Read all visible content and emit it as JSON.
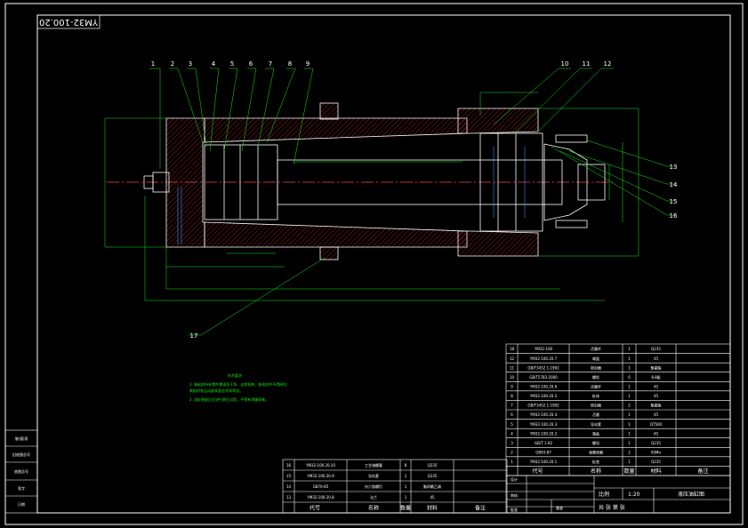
{
  "drawing_number": "YM32-100.20",
  "balloons": [
    "1",
    "2",
    "3",
    "4",
    "5",
    "6",
    "7",
    "8",
    "9",
    "10",
    "11",
    "12",
    "13",
    "14",
    "15",
    "16",
    "17"
  ],
  "notes": {
    "title": "技术要求",
    "lines": [
      "1. 装配前所有零件需清洗干净，去除毛刺，各密封件不得损伤；",
      "   装配时各运动副表面应涂润滑油；",
      "2. 油缸装配后应进行耐压试验，不得有渗漏现象。"
    ]
  },
  "parts_list": {
    "rows": [
      [
        "18",
        "YM32-100",
        "活塞杆",
        "1",
        "Q235",
        ""
      ],
      [
        "12",
        "YM32-100.20.7",
        "端盖",
        "1",
        "45",
        ""
      ],
      [
        "11",
        "GB/T3452.1-1992",
        "密封圈",
        "1",
        "聚氨酯",
        ""
      ],
      [
        "10",
        "GB/T5783-2000",
        "螺栓",
        "6",
        "8.8级",
        ""
      ],
      [
        "9",
        "YM32-100.20.6",
        "活塞杆",
        "1",
        "45",
        ""
      ],
      [
        "8",
        "YM32-100.20.5",
        "缸体",
        "1",
        "45",
        ""
      ],
      [
        "7",
        "GB/T3452.1-1992",
        "密封圈",
        "2",
        "聚氨酯",
        ""
      ],
      [
        "6",
        "YM32-100.20.4",
        "活塞",
        "1",
        "45",
        ""
      ],
      [
        "5",
        "YM32-100.20.3",
        "导向套",
        "1",
        "QT500",
        ""
      ],
      [
        "4",
        "YM32-100.20.2",
        "端盖",
        "1",
        "45",
        ""
      ],
      [
        "3",
        "GB/T 1-92",
        "螺母",
        "1",
        "Q235",
        ""
      ],
      [
        "2",
        "GB93-87",
        "弹簧垫圈",
        "2",
        "65Mn",
        ""
      ],
      [
        "1",
        "YM32-100.20.1",
        "缸底",
        "1",
        "Q235",
        ""
      ]
    ],
    "header": [
      "代号",
      "名称",
      "数量",
      "材料",
      "备注"
    ]
  },
  "std_list": {
    "rows": [
      [
        "16",
        "YM32-100.20.10",
        "工艺堵螺塞",
        "8",
        "Q235",
        ""
      ],
      [
        "15",
        "YM32-100.20.9",
        "导向套",
        "1",
        "Q235",
        ""
      ],
      [
        "14",
        "GB70-85",
        "内六角螺钉",
        "1",
        "聚四氟乙烯",
        ""
      ],
      [
        "13",
        "YM32-100.20.8",
        "法兰",
        "1",
        "45",
        ""
      ]
    ],
    "header": [
      "代号",
      "名称",
      "数量",
      "材料",
      "备注"
    ]
  },
  "title_block": {
    "design": "设计",
    "check": "审核",
    "approve": "批准",
    "scale_label": "比例",
    "scale": "1:20",
    "title": "液压油缸图",
    "sheet": "共 张 第 张",
    "weight_label": "重量"
  },
  "side_stamp": [
    "借(通)用",
    "旧底图总号",
    "底图总号",
    "签字",
    "日期"
  ],
  "colors": {
    "outline": "#ffffff",
    "dim": "#19e619",
    "hatch": "#ff3030",
    "center": "#ff4040",
    "hidden": "#3b8cff",
    "background": "#000000"
  }
}
